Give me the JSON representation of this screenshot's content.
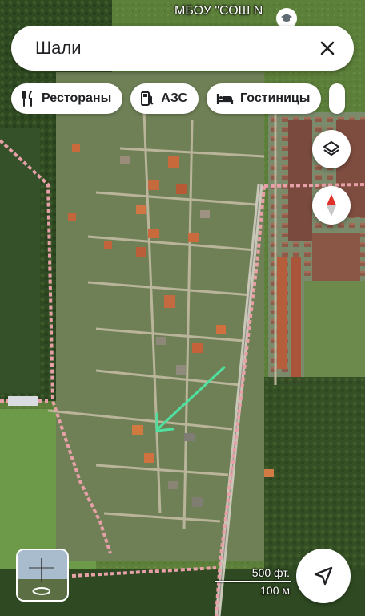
{
  "map": {
    "poi_label": "МБОУ \"СОШ N",
    "poi_icon": "school-icon"
  },
  "search": {
    "value": "Шали",
    "close_icon": "close-icon"
  },
  "chips": [
    {
      "label": "Рестораны",
      "icon": "restaurant-icon"
    },
    {
      "label": "АЗС",
      "icon": "gas-station-icon"
    },
    {
      "label": "Гостиницы",
      "icon": "hotel-icon"
    }
  ],
  "controls": {
    "layers_icon": "layers-icon",
    "compass_icon": "compass-icon",
    "navigate_icon": "navigation-arrow-icon",
    "streetview_icon": "rotate-360-icon"
  },
  "scale": {
    "imperial": "500 фт.",
    "metric": "100 м"
  },
  "colors": {
    "boundary": "#e8a0a8",
    "arrow": "#4fe0a0",
    "compass_red": "#e0302a"
  }
}
